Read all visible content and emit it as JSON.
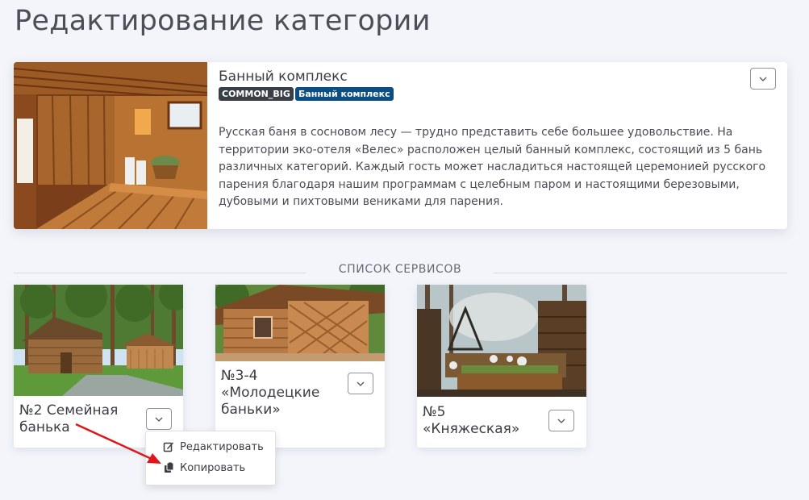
{
  "page": {
    "title": "Редактирование категории"
  },
  "category": {
    "title": "Банный комплекс",
    "tags": [
      "COMMON_BIG",
      "Банный комплекс"
    ],
    "description": "Русская баня в сосновом лесу — трудно представить себе большее удовольствие. На территории эко-отеля «Велес» расположен целый банный комплекс, состоящий из 5 бань различных категорий. Каждый гость может насладиться настоящей церемонией русского парения благодаря нашим программам с целебным паром и настоящими березовыми, дубовыми и пихтовыми вениками для парения.",
    "dropdown_icon": "chevron-down-icon"
  },
  "services_section": {
    "title": "СПИСОК СЕРВИСОВ"
  },
  "services": [
    {
      "name": "№2 Семейная банька"
    },
    {
      "name": "№3-4 «Молодецкие баньки»"
    },
    {
      "name": "№5 «Княжеская»"
    }
  ],
  "context_menu": {
    "items": [
      {
        "label": "Редактировать",
        "icon": "edit-icon"
      },
      {
        "label": "Копировать",
        "icon": "copy-icon"
      }
    ]
  },
  "colors": {
    "background": "#f3f5fa",
    "tag_dark": "#3a3f47",
    "tag_blue": "#0c4f85",
    "annotation_arrow": "#e0161b"
  }
}
